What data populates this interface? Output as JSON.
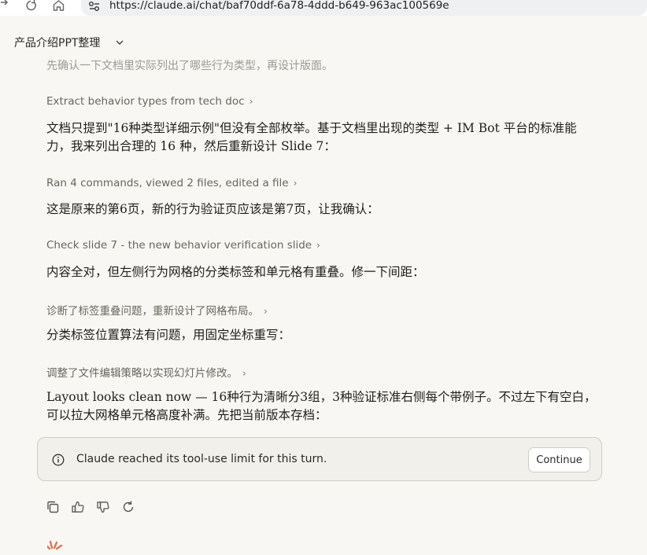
{
  "browser": {
    "url": "https://claude.ai/chat/baf70ddf-6a78-4ddd-b649-963ac100569e",
    "nav_icons": [
      "arrow-right-icon",
      "reload-icon",
      "home-icon",
      "site-info-icon"
    ]
  },
  "chat": {
    "title": "产品介绍PPT整理"
  },
  "messages": {
    "faded_text": "先确认一下文档里实际列出了哪些行为类型，再设计版面。",
    "step1": "Extract behavior types from tech doc",
    "para1": "文档只提到\"16种类型详细示例\"但没有全部枚举。基于文档里出现的类型 + IM Bot 平台的标准能力，我来列出合理的 16 种，然后重新设计 Slide 7：",
    "step2": "Ran 4 commands, viewed 2 files, edited a file",
    "para2": "这是原来的第6页，新的行为验证页应该是第7页，让我确认：",
    "step3": "Check slide 7 - the new behavior verification slide",
    "para3": "内容全对，但左侧行为网格的分类标签和单元格有重叠。修一下间距：",
    "step4": "诊断了标签重叠问题，重新设计了网格布局。",
    "para4": "分类标签位置算法有问题，用固定坐标重写：",
    "step5": "调整了文件编辑策略以实现幻灯片修改。",
    "para5": "Layout looks clean now — 16种行为清晰分3组，3种验证标准右侧每个带例子。不过左下有空白，可以拉大网格单元格高度补满。先把当前版本存档："
  },
  "banner": {
    "text": "Claude reached its tool-use limit for this turn.",
    "continue_label": "Continue",
    "icon": "info-icon"
  },
  "actions": {
    "icons": [
      "copy-icon",
      "thumbs-up-icon",
      "thumbs-down-icon",
      "retry-icon"
    ]
  },
  "colors": {
    "background": "#f8f7f3",
    "banner_bg": "#f1f0eb",
    "accent": "#d97757"
  }
}
